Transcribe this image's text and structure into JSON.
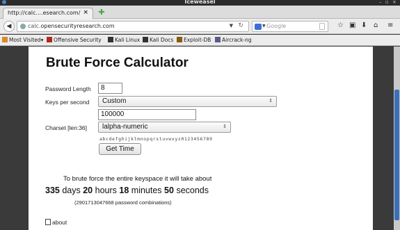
{
  "window": {
    "title": "Iceweasel",
    "controls": [
      "–",
      "▫",
      "×"
    ]
  },
  "tab": {
    "title": "http://calc....esearch.com/",
    "close": "×",
    "new_tab": "✚"
  },
  "navbar": {
    "url_prefix": "calc.",
    "url_domain": "opensecurityresearch.com",
    "search_placeholder": "Google",
    "icons": [
      "star-icon",
      "clipboard-icon",
      "download-icon",
      "home-icon",
      "menu-icon"
    ]
  },
  "bookmarks": [
    "Most Visited▾",
    "Offensive Security",
    "Kali Linux",
    "Kali Docs",
    "Exploit-DB",
    "Aircrack-ng"
  ],
  "page": {
    "title": "Brute Force Calculator",
    "password_length_label": "Password Length",
    "password_length_value": "8",
    "keys_per_second_label": "Keys per second",
    "keys_per_second_selected": "Custom",
    "custom_keys_value": "100000",
    "charset_label": "Charset [len:36]",
    "charset_selected": "lalpha-numeric",
    "charset_preview": "abcdefghijklmnopqrstuvwxyz0123456789",
    "get_time_button": "Get Time",
    "result_intro": "To brute force the entire keyspace it will take about",
    "result": {
      "days": "335",
      "days_unit": "days",
      "hours": "20",
      "hours_unit": "hours",
      "minutes": "18",
      "minutes_unit": "minutes",
      "seconds": "50",
      "seconds_unit": "seconds"
    },
    "combinations": "(2901713047668 password combinations)",
    "about_link": "about"
  }
}
